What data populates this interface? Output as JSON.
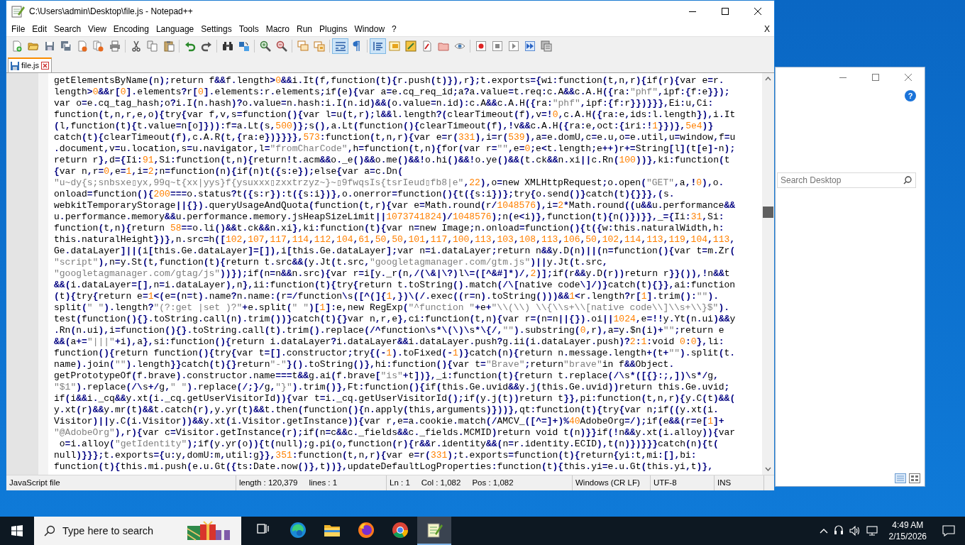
{
  "window": {
    "title": "C:\\Users\\admin\\Desktop\\file.js - Notepad++"
  },
  "menu": [
    "File",
    "Edit",
    "Search",
    "View",
    "Encoding",
    "Language",
    "Settings",
    "Tools",
    "Macro",
    "Run",
    "Plugins",
    "Window",
    "?"
  ],
  "menu_close": "X",
  "toolbar": [
    [
      {
        "kind": "new",
        "pressed": false
      },
      {
        "kind": "open",
        "pressed": false
      },
      {
        "kind": "save",
        "pressed": false
      },
      {
        "kind": "saveall",
        "pressed": false
      },
      {
        "kind": "close",
        "pressed": false
      },
      {
        "kind": "closeall",
        "pressed": false
      },
      {
        "kind": "print",
        "pressed": false
      }
    ],
    [
      {
        "kind": "cut",
        "pressed": false
      },
      {
        "kind": "copy",
        "pressed": false
      },
      {
        "kind": "paste",
        "pressed": false
      }
    ],
    [
      {
        "kind": "undo",
        "pressed": false
      },
      {
        "kind": "redo",
        "pressed": false
      }
    ],
    [
      {
        "kind": "find",
        "pressed": false
      },
      {
        "kind": "replace",
        "pressed": false
      }
    ],
    [
      {
        "kind": "zoomin",
        "pressed": false
      },
      {
        "kind": "zoomout",
        "pressed": false
      }
    ],
    [
      {
        "kind": "syncv",
        "pressed": false
      },
      {
        "kind": "synch",
        "pressed": false
      }
    ],
    [
      {
        "kind": "wrap",
        "pressed": true
      },
      {
        "kind": "pilcrow",
        "pressed": false
      }
    ],
    [
      {
        "kind": "indent",
        "pressed": true
      },
      {
        "kind": "lang",
        "pressed": false
      },
      {
        "kind": "docmap",
        "pressed": false
      },
      {
        "kind": "funclist",
        "pressed": false
      },
      {
        "kind": "folder",
        "pressed": false
      },
      {
        "kind": "monitor",
        "pressed": false
      }
    ],
    [
      {
        "kind": "record",
        "pressed": false
      },
      {
        "kind": "stop",
        "pressed": false
      },
      {
        "kind": "play",
        "pressed": false
      },
      {
        "kind": "playmulti",
        "pressed": false
      },
      {
        "kind": "savemacro",
        "pressed": false
      }
    ]
  ],
  "tabs": [
    {
      "label": "file.js",
      "selected": true
    }
  ],
  "editor": {
    "lines": [
      "getElementsByName(n);return f&&f.length>0&&i.It(f,function(t){r.push(t)}),r};t.exports={wi:function(t,n,r){if(r){var e=r.",
      "length>0&&r[0].elements?r[0].elements:r.elements;if(e){var a=e.cq_req_id;a?a.value=t.req:c.A&&c.A.H({ra:\"phf\",ipf:{f:e}});",
      "var o=e.cq_tag_hash;o?i.I(n.hash)?o.value=n.hash:i.I(n.id)&&(o.value=n.id):c.A&&c.A.H({ra:\"phf\",ipf:{f:r}})}}},Ei:u,Ci:",
      "function(t,n,r,e,o){try{var f,v,s=function(){var l=u(t,r);l&&l.length?(clearTimeout(f),v=!0,c.A.H({ra:e,ids:l.length}),i.It",
      "(l,function(t){t.value=n[o]})):f=a.Lt(s,500)};s(),a.Lt(function(){clearTimeout(f),!v&&c.A.H({ra:e,oct:{iri:!1}})},5e4)}",
      "catch(t){clearTimeout(f),c.A.R(t,{ra:e})}}}},573:function(t,n,r){var e=r(331),i=r(539),a=e.domU,c=e.u,o=e.util,u=window,f=u",
      ".document,v=u.location,s=u.navigator,l=\"fromCharCode\",h=function(t,n){for(var r=\"\",e=0;e<t.length;e++)r+=String[l](t[e]-n);",
      "return r},d={Ii:91,Si:function(t,n){return!t.acm&&o._e()&&o.me()&&!o.hi()&&!o.ye()&&(t.ck&&n.xi||c.Rn(100))},ki:function(t",
      "{var n,r=0,e=1,i=2;n=function(n){if(n)t({s:e});else{var a=c.Dn(",
      "\"u~dy{s;snbsxe▯yx,99q~t{xx|yys}f{ysuxxx▯zxxtrzyz~}~▯9fwqsIs{tsrIeud▯fb8|e\",22),o=new XMLHttpRequest;o.open(\"GET\",a,!0),o.",
      "onload=function(){200===o.status?t({s:r}):t({s:i})},o.onerror=function(){t({s:i})};try{o.send()}catch(t){}}},(s.",
      "webkitTemporaryStorage||{}).queryUsageAndQuota(function(t,r){var e=Math.round(r/1048576),i=2*Math.round((u&&u.performance&&",
      "u.performance.memory&&u.performance.memory.jsHeapSizeLimit||1073741824)/1048576);n(e<i)},function(t){n()})}},_={Ii:31,Si:",
      "function(t,n){return 58==o.li()&&t.ck&&n.xi},ki:function(t){var n=new Image;n.onload=function(){t({w:this.naturalWidth,h:",
      "this.naturalHeight})},n.src=h([102,107,117,114,112,104,61,50,50,101,117,100,113,103,108,113,106,50,102,114,113,119,104,113,",
      "Ge.dataLayer]||(i[this.Ge.dataLayer]=[]),i[this.Ge.dataLayer];var n=i.dataLayer;return n&&y.D(n)||(n=function(){var t=m.Zr(",
      "\"script\"),n=y.St(t,function(t){return t.src&&(y.Jt(t.src,\"googletagmanager.com/gtm.js\")||y.Jt(t.src,",
      "\"googletagmanager.com/gtag/js\"))});if(n=n&&n.src){var r=i[y._r(n,/(\\&|\\?)l\\=([^&#]*)/,2)];if(r&&y.D(r))return r}}()),!n&&t",
      "&&(i.dataLayer=[],n=i.dataLayer),n},ii:function(t){try{return t.toString().match(/\\[native code\\]/)}catch(t){}},ai:function",
      "(t){try{return e=1<(e=(n=t).name?n.name:(r=/function\\s([^(]{1,})\\(/.exec((r=n).toString()))&&1<r.length?r[1].trim():\"\").",
      "split(\" \").length?\"(?:get |set )?\"+e.split(\" \")[1]:e,new RegExp(\"^function \"+e+\"\\\\(\\\\) \\\\{\\\\s+\\\\[native code\\\\]\\\\s+\\\\}$\").",
      "test(function(){}.toString.call(n).trim())}catch(t){}var n,r,e},ci:function(t,n){var r=(n=n||{}).oi||1024,e=!!y.Yt(n.ui)&&y",
      ".Rn(n.ui),i=function(){}.toString.call(t).trim().replace(/^function\\s*\\(\\)\\s*\\{/,\"\").substring(0,r),a=y.$n(i)+\"\";return e",
      "&&(a+=\"|||\"+i),a},si:function(){return i.dataLayer?i.dataLayer&&i.dataLayer.push?g.ii(i.dataLayer.push)?2:1:void 0:0},li:",
      "function(){return function(){try{var t=[].constructor;try{(-1).toFixed(-1)}catch(n){return n.message.length+(t+\"\").split(t.",
      "name).join(\"\").length}}catch(t){}return\"-\"}().toString()},hi:function(){var t=\"Brave\";return\"brave\"in f&&Object.",
      "getPrototypeOf(f.brave).constructor.name===t&&g.ai(f.brave[\"is\"+t])},_i:function(t){return t.replace(/\\s*([{}:;,])\\s*/g,",
      "\"$1\").replace(/\\s+/g,\" \").replace(/;}/g,\"}\").trim()},Ft:function(){if(this.Ge.uvid&&y.j(this.Ge.uvid))return this.Ge.uvid;",
      "if(i&&i._cq&&y.xt(i._cq.getUserVisitorId)){var t=i._cq.getUserVisitorId();if(y.j(t))return t}},pi:function(t,n,r){y.C(t)&&(",
      "y.xt(r)&&y.mr(t)&&t.catch(r),y.yr(t)&&t.then(function(){n.apply(this,arguments)}))},qt:function(t){try{var n;if((y.xt(i.",
      "Visitor)||y.C(i.Visitor))&&y.xt(i.Visitor.getInstance)){var r,e=a.cookie.match(/AMCV_([^=]+)%40AdobeOrg=/);if(e&&(r=e[1]+",
      "\"@AdobeOrg\"),r){var c=Visitor.getInstance(r);if(n=c&&c._fields&&c._fields.MCMID)return void t(n)}}if(!n&&y.xt(i.alloy)){var",
      " o=i.alloy(\"getIdentity\");if(y.yr(o)){t(null);g.pi(o,function(r){r&&r.identity&&(n=r.identity.ECID),t(n)})}}}catch(n){t(",
      "null)}}};t.exports={u:y,domU:m,util:g}},351:function(t,n,r){var e=r(331);t.exports=function(t){return{yi:t,mi:[],bi:",
      "function(t){this.mi.push(e.u.Gt({ts:Date.now()},t))},updateDefaultLogProperties:function(t){this.yi=e.u.Gt(this.yi,t)},"
    ]
  },
  "status_bar": [
    [
      "JavaScript file"
    ],
    [
      "length : 120,379",
      "lines : 1"
    ],
    [
      "Ln : 1",
      "Col : 1,082",
      "Pos : 1,082"
    ],
    [
      "Windows (CR LF)"
    ],
    [
      "UTF-8"
    ],
    [
      "INS"
    ]
  ],
  "background_window": {
    "search": {
      "placeholder": "Search Desktop"
    },
    "help": "?"
  },
  "taskbar": {
    "search": {
      "placeholder": "Type here to search"
    },
    "apps": [
      {
        "kind": "taskview",
        "selected": false
      },
      {
        "kind": "edge",
        "selected": false
      },
      {
        "kind": "explorer",
        "selected": false
      },
      {
        "kind": "firefox",
        "selected": false
      },
      {
        "kind": "chrome",
        "selected": false
      },
      {
        "kind": "notepad",
        "selected": true
      }
    ],
    "time": "4:49 AM",
    "date": "2/15/2026"
  }
}
